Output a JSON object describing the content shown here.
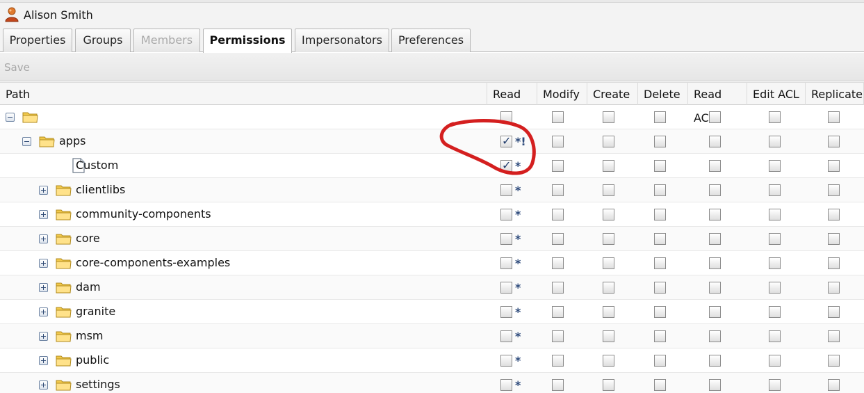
{
  "user": {
    "name": "Alison Smith",
    "icon": "user-icon"
  },
  "tabs": [
    {
      "label": "Properties",
      "state": "normal"
    },
    {
      "label": "Groups",
      "state": "normal"
    },
    {
      "label": "Members",
      "state": "disabled"
    },
    {
      "label": "Permissions",
      "state": "active"
    },
    {
      "label": "Impersonators",
      "state": "normal"
    },
    {
      "label": "Preferences",
      "state": "normal"
    }
  ],
  "toolbar": {
    "save_label": "Save"
  },
  "grid": {
    "columns": [
      "Path",
      "Read",
      "Modify",
      "Create",
      "Delete",
      "Read ACL",
      "Edit ACL",
      "Replicate"
    ],
    "rows": [
      {
        "label": "",
        "depth": 0,
        "type": "folder",
        "expander": "minus",
        "read": false,
        "read_marker": "",
        "others": [
          false,
          false,
          false,
          false,
          false,
          false
        ]
      },
      {
        "label": "apps",
        "depth": 1,
        "type": "folder",
        "expander": "minus",
        "read": true,
        "read_marker": "*!",
        "others": [
          false,
          false,
          false,
          false,
          false,
          false
        ]
      },
      {
        "label": "Custom",
        "depth": 2,
        "type": "file",
        "expander": "",
        "read": true,
        "read_marker": "*",
        "others": [
          false,
          false,
          false,
          false,
          false,
          false
        ]
      },
      {
        "label": "clientlibs",
        "depth": 2,
        "type": "folder",
        "expander": "plus",
        "read": false,
        "read_marker": "*",
        "others": [
          false,
          false,
          false,
          false,
          false,
          false
        ]
      },
      {
        "label": "community-components",
        "depth": 2,
        "type": "folder",
        "expander": "plus",
        "read": false,
        "read_marker": "*",
        "others": [
          false,
          false,
          false,
          false,
          false,
          false
        ]
      },
      {
        "label": "core",
        "depth": 2,
        "type": "folder",
        "expander": "plus",
        "read": false,
        "read_marker": "*",
        "others": [
          false,
          false,
          false,
          false,
          false,
          false
        ]
      },
      {
        "label": "core-components-examples",
        "depth": 2,
        "type": "folder",
        "expander": "plus",
        "read": false,
        "read_marker": "*",
        "others": [
          false,
          false,
          false,
          false,
          false,
          false
        ]
      },
      {
        "label": "dam",
        "depth": 2,
        "type": "folder",
        "expander": "plus",
        "read": false,
        "read_marker": "*",
        "others": [
          false,
          false,
          false,
          false,
          false,
          false
        ]
      },
      {
        "label": "granite",
        "depth": 2,
        "type": "folder",
        "expander": "plus",
        "read": false,
        "read_marker": "*",
        "others": [
          false,
          false,
          false,
          false,
          false,
          false
        ]
      },
      {
        "label": "msm",
        "depth": 2,
        "type": "folder",
        "expander": "plus",
        "read": false,
        "read_marker": "*",
        "others": [
          false,
          false,
          false,
          false,
          false,
          false
        ]
      },
      {
        "label": "public",
        "depth": 2,
        "type": "folder",
        "expander": "plus",
        "read": false,
        "read_marker": "*",
        "others": [
          false,
          false,
          false,
          false,
          false,
          false
        ]
      },
      {
        "label": "settings",
        "depth": 2,
        "type": "folder",
        "expander": "plus",
        "read": false,
        "read_marker": "*",
        "others": [
          false,
          false,
          false,
          false,
          false,
          false
        ]
      }
    ]
  },
  "annotation": {
    "color": "#d41f1f"
  },
  "colors": {
    "folder": "#f2c94c",
    "checkmark": "#1f3b6b",
    "star": "#2d4a7b"
  }
}
